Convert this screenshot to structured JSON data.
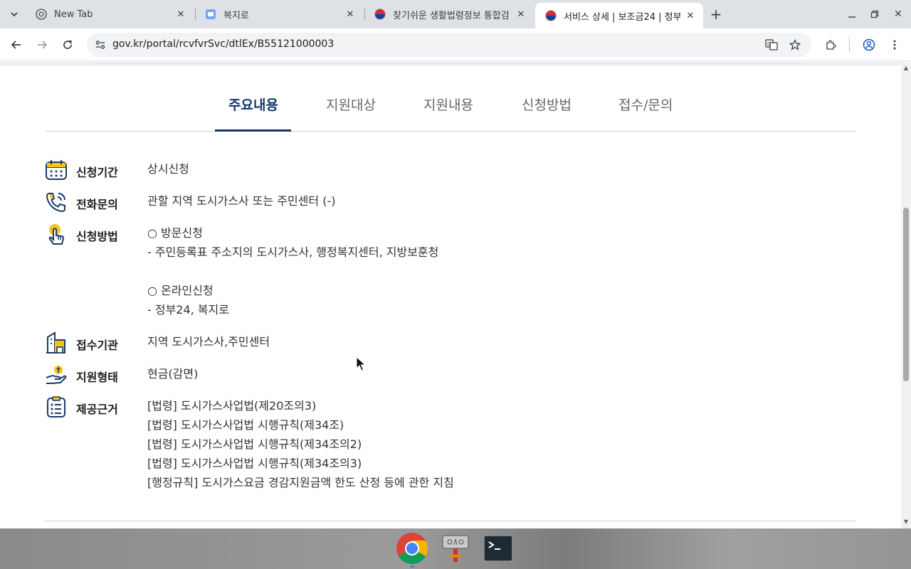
{
  "browser": {
    "tabs": [
      {
        "title": "New Tab",
        "favicon": "chrome-icon"
      },
      {
        "title": "복지로",
        "favicon": "bokjiro-icon"
      },
      {
        "title": "찾기쉬운 생활법령정보 통합검",
        "favicon": "gov-emblem-icon"
      },
      {
        "title": "서비스 상세 | 보조금24 | 정부",
        "favicon": "gov-emblem-icon",
        "active": true
      }
    ],
    "url": "gov.kr/portal/rcvfvrSvc/dtlEx/B55121000003"
  },
  "section_tabs": [
    "주요내용",
    "지원대상",
    "지원내용",
    "신청방법",
    "접수/문의"
  ],
  "active_section_tab": "주요내용",
  "details": {
    "period": {
      "label": "신청기간",
      "icon": "calendar-icon",
      "lines": [
        "상시신청"
      ]
    },
    "phone": {
      "label": "전화문의",
      "icon": "phone-icon",
      "lines": [
        "관할 지역 도시가스사 또는 주민센터 (-)"
      ]
    },
    "method": {
      "label": "신청방법",
      "icon": "touch-icon",
      "lines": [
        "○ 방문신청",
        "- 주민등록표 주소지의 도시가스사, 행정복지센터, 지방보훈청",
        "",
        "○ 온라인신청",
        "- 정부24, 복지로"
      ]
    },
    "agency": {
      "label": "접수기관",
      "icon": "building-icon",
      "lines": [
        "지역 도시가스사,주민센터"
      ]
    },
    "support_type": {
      "label": "지원형태",
      "icon": "hand-coin-icon",
      "lines": [
        "현금(감면)"
      ]
    },
    "legal_basis": {
      "label": "제공근거",
      "icon": "list-icon",
      "lines": [
        "[법령] 도시가스사업법(제20조의3)",
        "[법령] 도시가스사업법 시행규칙(제34조)",
        "[법령] 도시가스사업법 시행규칙(제34조의2)",
        "[법령] 도시가스사업법 시행규칙(제34조의3)",
        "[행정규칙] 도시가스요금 경감지원금액 한도 산정 등에 관한 지침"
      ]
    }
  },
  "colors": {
    "accent": "#12366b",
    "icon_yellow": "#f5c518",
    "icon_navy": "#1b3a6b"
  }
}
